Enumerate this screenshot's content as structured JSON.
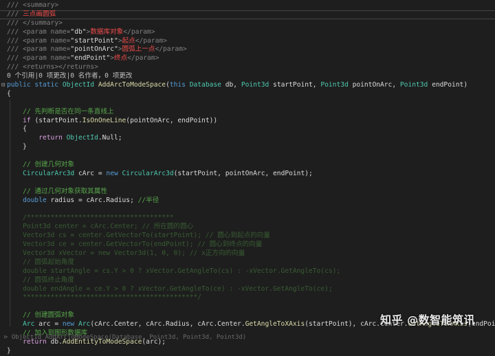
{
  "editor": {
    "lines": [
      [
        {
          "t": "/// ",
          "c": "c-tag"
        },
        {
          "t": "<summary>",
          "c": "c-tag"
        }
      ],
      [
        {
          "t": "/// ",
          "c": "c-tag"
        },
        {
          "t": "三点画圆弧",
          "c": "c-red"
        }
      ],
      [
        {
          "t": "/// ",
          "c": "c-tag"
        },
        {
          "t": "</summary>",
          "c": "c-tag"
        }
      ],
      [
        {
          "t": "/// ",
          "c": "c-tag"
        },
        {
          "t": "<param name=",
          "c": "c-tag"
        },
        {
          "t": "\"db\"",
          "c": "c-plain"
        },
        {
          "t": ">",
          "c": "c-tag"
        },
        {
          "t": "数据库对象",
          "c": "c-red"
        },
        {
          "t": "</param>",
          "c": "c-tag"
        }
      ],
      [
        {
          "t": "/// ",
          "c": "c-tag"
        },
        {
          "t": "<param name=",
          "c": "c-tag"
        },
        {
          "t": "\"startPoint\"",
          "c": "c-plain"
        },
        {
          "t": ">",
          "c": "c-tag"
        },
        {
          "t": "起点",
          "c": "c-red"
        },
        {
          "t": "</param>",
          "c": "c-tag"
        }
      ],
      [
        {
          "t": "/// ",
          "c": "c-tag"
        },
        {
          "t": "<param name=",
          "c": "c-tag"
        },
        {
          "t": "\"pointOnArc\"",
          "c": "c-plain"
        },
        {
          "t": ">",
          "c": "c-tag"
        },
        {
          "t": "圆弧上一点",
          "c": "c-red"
        },
        {
          "t": "</param>",
          "c": "c-tag"
        }
      ],
      [
        {
          "t": "/// ",
          "c": "c-tag"
        },
        {
          "t": "<param name=",
          "c": "c-tag"
        },
        {
          "t": "\"endPoint\"",
          "c": "c-plain"
        },
        {
          "t": ">",
          "c": "c-tag"
        },
        {
          "t": "终点",
          "c": "c-red"
        },
        {
          "t": "</param>",
          "c": "c-tag"
        }
      ],
      [
        {
          "t": "/// ",
          "c": "c-tag"
        },
        {
          "t": "<returns></returns>",
          "c": "c-tag"
        }
      ],
      [
        {
          "t": "0 个引用|0 项更改|0 名作者，0 项更改",
          "c": "c-meta"
        }
      ],
      [
        {
          "t": "public static ",
          "c": "c-kw"
        },
        {
          "t": "ObjectId ",
          "c": "c-type"
        },
        {
          "t": "AddArcToModeSpace",
          "c": "c-fn"
        },
        {
          "t": "(",
          "c": "c-plain"
        },
        {
          "t": "this ",
          "c": "c-kw"
        },
        {
          "t": "Database ",
          "c": "c-type"
        },
        {
          "t": "db, ",
          "c": "c-plain"
        },
        {
          "t": "Point3d ",
          "c": "c-type"
        },
        {
          "t": "startPoint, ",
          "c": "c-plain"
        },
        {
          "t": "Point3d ",
          "c": "c-type"
        },
        {
          "t": "pointOnArc, ",
          "c": "c-plain"
        },
        {
          "t": "Point3d ",
          "c": "c-type"
        },
        {
          "t": "endPoint)",
          "c": "c-plain"
        }
      ],
      [
        {
          "t": "{",
          "c": "c-plain"
        }
      ],
      [
        {
          "t": "",
          "c": "c-plain"
        }
      ],
      [
        {
          "t": "    // 先判断是否在同一条直线上",
          "c": "c-cmt"
        }
      ],
      [
        {
          "t": "    ",
          "c": "c-plain"
        },
        {
          "t": "if ",
          "c": "c-ctrl"
        },
        {
          "t": "(startPoint.",
          "c": "c-plain"
        },
        {
          "t": "IsOnOneLine",
          "c": "c-fn"
        },
        {
          "t": "(pointOnArc, endPoint))",
          "c": "c-plain"
        }
      ],
      [
        {
          "t": "    {",
          "c": "c-plain"
        }
      ],
      [
        {
          "t": "        ",
          "c": "c-plain"
        },
        {
          "t": "return ",
          "c": "c-ctrl"
        },
        {
          "t": "ObjectId",
          "c": "c-type"
        },
        {
          "t": ".Null;",
          "c": "c-plain"
        }
      ],
      [
        {
          "t": "    }",
          "c": "c-plain"
        }
      ],
      [
        {
          "t": "",
          "c": "c-plain"
        }
      ],
      [
        {
          "t": "    // 创建几何对象",
          "c": "c-cmt"
        }
      ],
      [
        {
          "t": "    ",
          "c": "c-plain"
        },
        {
          "t": "CircularArc3d ",
          "c": "c-type"
        },
        {
          "t": "cArc = ",
          "c": "c-plain"
        },
        {
          "t": "new ",
          "c": "c-kw"
        },
        {
          "t": "CircularArc3d",
          "c": "c-type"
        },
        {
          "t": "(startPoint, pointOnArc, endPoint);",
          "c": "c-plain"
        }
      ],
      [
        {
          "t": "",
          "c": "c-plain"
        }
      ],
      [
        {
          "t": "    // 通过几何对象获取其属性",
          "c": "c-cmt"
        }
      ],
      [
        {
          "t": "    ",
          "c": "c-plain"
        },
        {
          "t": "double ",
          "c": "c-kw"
        },
        {
          "t": "radius = cArc.Radius; ",
          "c": "c-plain"
        },
        {
          "t": "//半径",
          "c": "c-cmt"
        }
      ],
      [
        {
          "t": "",
          "c": "c-plain"
        }
      ],
      [
        {
          "t": "    /*************************************",
          "c": "c-cmt dim"
        }
      ],
      [
        {
          "t": "    Point3d center = cArc.Center; // 所在圆的圆心",
          "c": "c-cmt dim"
        }
      ],
      [
        {
          "t": "    Vector3d cs = center.GetVectorTo(startPoint); // 圆心到起点的向量",
          "c": "c-cmt dim"
        }
      ],
      [
        {
          "t": "    Vector3d ce = center.GetVectorTo(endPoint); // 圆心到终点的向量",
          "c": "c-cmt dim"
        }
      ],
      [
        {
          "t": "    Vector3d xVector = new Vector3d(1, 0, 0); // x正方向的向量",
          "c": "c-cmt dim"
        }
      ],
      [
        {
          "t": "    // 圆弧起始角度",
          "c": "c-cmt dim"
        }
      ],
      [
        {
          "t": "    double startAngle = cs.Y > 0 ? xVector.GetAngleTo(cs) : -xVector.GetAngleTo(cs);",
          "c": "c-cmt dim"
        }
      ],
      [
        {
          "t": "    // 圆弧终止角度",
          "c": "c-cmt dim"
        }
      ],
      [
        {
          "t": "    double endAngle = ce.Y > 0 ? xVector.GetAngleTo(ce) : -xVector.GetAngleTo(ce);",
          "c": "c-cmt dim"
        }
      ],
      [
        {
          "t": "    ********************************************/",
          "c": "c-cmt dim"
        }
      ],
      [
        {
          "t": "",
          "c": "c-plain"
        }
      ],
      [
        {
          "t": "    // 创建圆弧对象",
          "c": "c-cmt"
        }
      ],
      [
        {
          "t": "    ",
          "c": "c-plain"
        },
        {
          "t": "Arc ",
          "c": "c-type"
        },
        {
          "t": "arc = ",
          "c": "c-plain"
        },
        {
          "t": "new ",
          "c": "c-kw"
        },
        {
          "t": "Arc",
          "c": "c-type"
        },
        {
          "t": "(cArc.Center, cArc.Radius, cArc.Center.",
          "c": "c-plain"
        },
        {
          "t": "GetAngleToXAxis",
          "c": "c-fn"
        },
        {
          "t": "(startPoint), cArc.Center.",
          "c": "c-plain"
        },
        {
          "t": "GetAngleToXAxis",
          "c": "c-fn"
        },
        {
          "t": "(endPoint));",
          "c": "c-plain"
        }
      ],
      [
        {
          "t": "    // 加入到图形数据库",
          "c": "c-cmt"
        }
      ],
      [
        {
          "t": "    ",
          "c": "c-plain"
        },
        {
          "t": "return ",
          "c": "c-ctrl"
        },
        {
          "t": "db.",
          "c": "c-plain"
        },
        {
          "t": "AddEntityToModeSpace",
          "c": "c-fn"
        },
        {
          "t": "(arc);",
          "c": "c-plain"
        }
      ],
      [
        {
          "t": "}",
          "c": "c-plain"
        }
      ]
    ],
    "peek_text": "⊳ ObjectId AddArcToModeSpace(Database, Point3d, Point3d, Point3d)",
    "watermark": "知乎 @数智能筑讯"
  }
}
